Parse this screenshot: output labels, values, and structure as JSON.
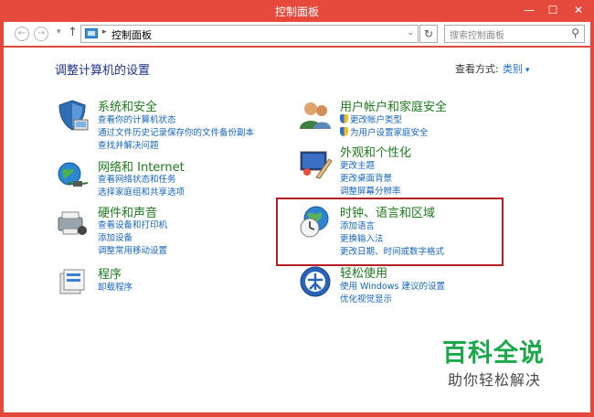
{
  "window": {
    "title": "控制面板",
    "min_label": "—",
    "max_label": "☐",
    "close_label": "✕"
  },
  "addressbar": {
    "back_glyph": "←",
    "forward_glyph": "→",
    "dropdown_glyph": "▾",
    "up_glyph": "↑",
    "separator": "▸",
    "path": "控制面板",
    "path_dropdown": "⌄",
    "refresh_glyph": "↻",
    "search_placeholder": "搜索控制面板",
    "search_glyph": "⚲"
  },
  "main": {
    "heading": "调整计算机的设置",
    "view_by_label": "查看方式:",
    "view_by_value": "类别",
    "categories": [
      {
        "title": "系统和安全",
        "icon": "system-security-icon",
        "links": [
          "查看你的计算机状态",
          "通过文件历史记录保存你的文件备份副本",
          "查找并解决问题"
        ]
      },
      {
        "title": "网络和 Internet",
        "icon": "network-icon",
        "links": [
          "查看网络状态和任务",
          "选择家庭组和共享选项"
        ]
      },
      {
        "title": "硬件和声音",
        "icon": "hardware-sound-icon",
        "links": [
          "查看设备和打印机",
          "添加设备",
          "调整常用移动设置"
        ]
      },
      {
        "title": "程序",
        "icon": "programs-icon",
        "links": [
          "卸载程序"
        ]
      },
      {
        "title": "用户帐户和家庭安全",
        "icon": "user-accounts-icon",
        "links": [
          "更改帐户类型",
          "为用户设置家庭安全"
        ],
        "shield_links": [
          true,
          true
        ]
      },
      {
        "title": "外观和个性化",
        "icon": "appearance-icon",
        "links": [
          "更改主题",
          "更改桌面背景",
          "调整屏幕分辨率"
        ]
      },
      {
        "title": "时钟、语言和区域",
        "icon": "clock-region-icon",
        "links": [
          "添加语言",
          "更换输入法",
          "更改日期、时间或数字格式"
        ]
      },
      {
        "title": "轻松使用",
        "icon": "ease-of-access-icon",
        "links": [
          "使用 Windows 建议的设置",
          "优化视觉显示"
        ]
      }
    ]
  },
  "watermark": {
    "big": "百科全说",
    "small": "助你轻松解决"
  },
  "colors": {
    "titlebar": "#e54a3c",
    "category_title": "#1e7b1e",
    "link": "#1565c0",
    "heading": "#1e3287",
    "highlight": "#b41f24",
    "watermark": "#1ba84a"
  }
}
